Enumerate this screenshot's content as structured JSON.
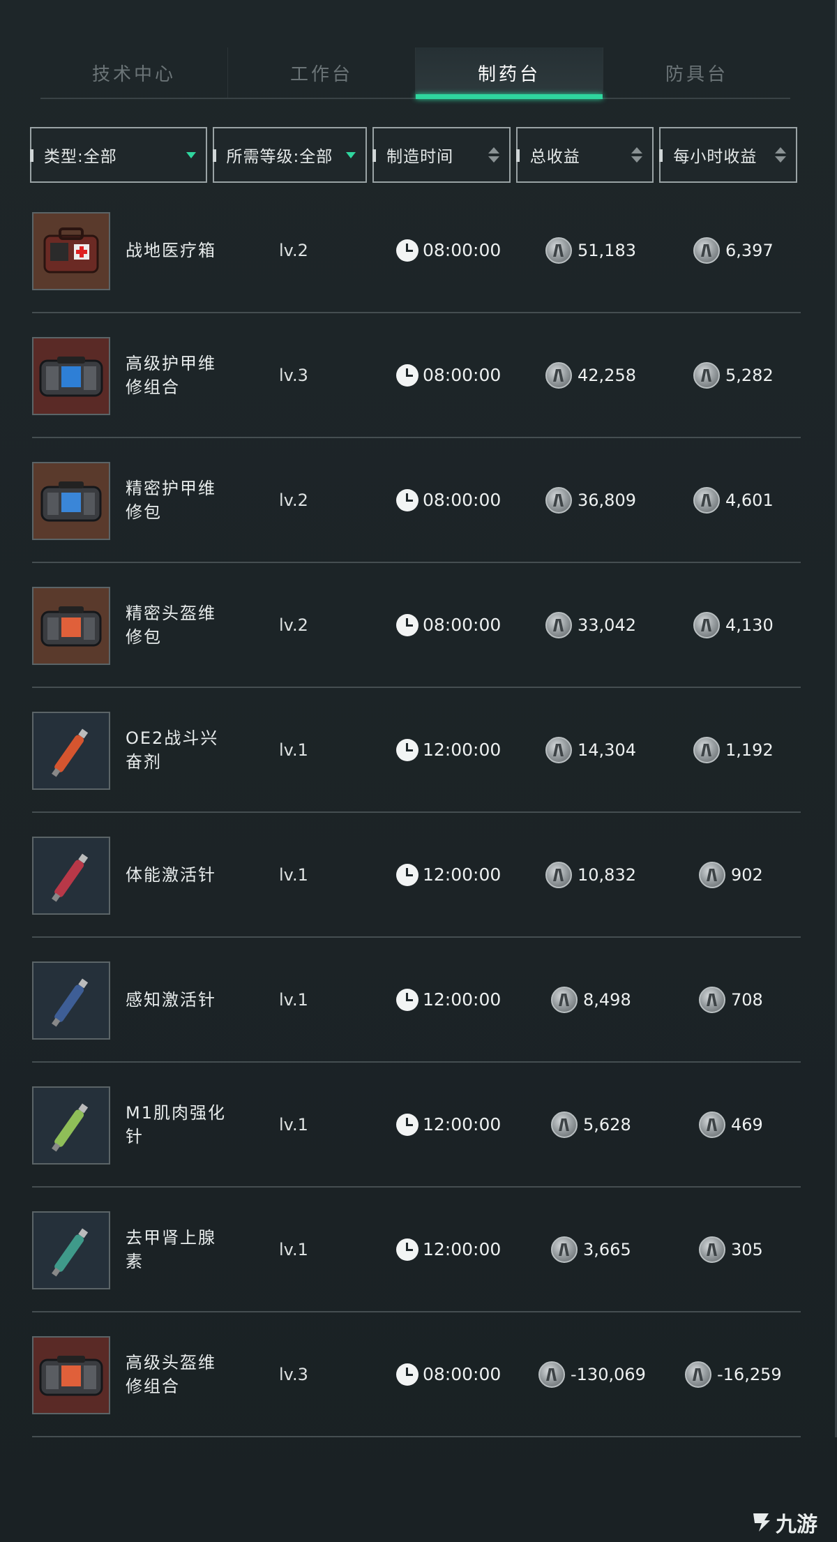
{
  "tabs": [
    {
      "label": "技术中心",
      "active": false
    },
    {
      "label": "工作台",
      "active": false
    },
    {
      "label": "制药台",
      "active": true
    },
    {
      "label": "防具台",
      "active": false
    }
  ],
  "filters": {
    "type": "类型:全部",
    "level": "所需等级:全部",
    "time": "制造时间",
    "total": "总收益",
    "hourly": "每小时收益"
  },
  "items": [
    {
      "name": "战地医疗箱",
      "icon": "medkit-icon",
      "level": "lv.2",
      "time": "08:00:00",
      "total": "51,183",
      "hourly": "6,397"
    },
    {
      "name": "高级护甲维修组合",
      "icon": "armor-repair-kit-icon",
      "level": "lv.3",
      "time": "08:00:00",
      "total": "42,258",
      "hourly": "5,282"
    },
    {
      "name": "精密护甲维修包",
      "icon": "armor-repair-bag-icon",
      "level": "lv.2",
      "time": "08:00:00",
      "total": "36,809",
      "hourly": "4,601"
    },
    {
      "name": "精密头盔维修包",
      "icon": "helmet-repair-bag-icon",
      "level": "lv.2",
      "time": "08:00:00",
      "total": "33,042",
      "hourly": "4,130"
    },
    {
      "name": "OE2战斗兴奋剂",
      "icon": "injector-icon",
      "level": "lv.1",
      "time": "12:00:00",
      "total": "14,304",
      "hourly": "1,192"
    },
    {
      "name": "体能激活针",
      "icon": "injector-icon",
      "level": "lv.1",
      "time": "12:00:00",
      "total": "10,832",
      "hourly": "902"
    },
    {
      "name": "感知激活针",
      "icon": "injector-icon",
      "level": "lv.1",
      "time": "12:00:00",
      "total": "8,498",
      "hourly": "708"
    },
    {
      "name": "M1肌肉强化针",
      "icon": "injector-icon",
      "level": "lv.1",
      "time": "12:00:00",
      "total": "5,628",
      "hourly": "469"
    },
    {
      "name": "去甲肾上腺素",
      "icon": "injector-icon",
      "level": "lv.1",
      "time": "12:00:00",
      "total": "3,665",
      "hourly": "305"
    },
    {
      "name": "高级头盔维修组合",
      "icon": "helmet-repair-kit-icon",
      "level": "lv.3",
      "time": "08:00:00",
      "total": "-130,069",
      "hourly": "-16,259"
    }
  ],
  "colors": {
    "accent": "#2fd69e",
    "background": "#1c2326"
  },
  "watermark": "九游"
}
